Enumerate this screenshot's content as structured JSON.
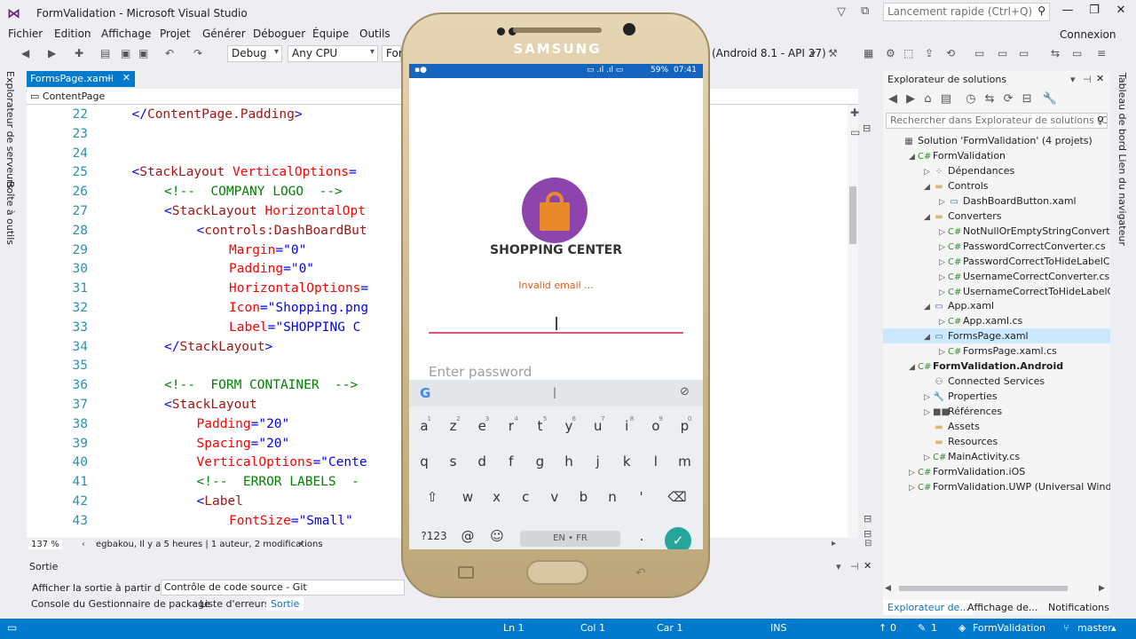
{
  "window": {
    "title": "FormValidation - Microsoft Visual Studio",
    "quick_launch": "Lancement rapide (Ctrl+Q)",
    "connexion": "Connexion"
  },
  "menu": [
    "Fichier",
    "Edition",
    "Affichage",
    "Projet",
    "Générer",
    "Déboguer",
    "Équipe",
    "Outils"
  ],
  "toolbar": {
    "config": "Debug",
    "platform": "Any CPU",
    "target_partial": "For",
    "device": "(Android 8.1 - API 27)"
  },
  "left_tabs": [
    "Explorateur de serveurs",
    "Boîte à outils"
  ],
  "editor": {
    "tab": "FormsPage.xaml",
    "breadcrumb": "ContentPage",
    "zoom": "137 %",
    "git_info": "egbakou, Il y a 5 heures | 1 auteur, 2 modifications",
    "lines": [
      {
        "n": "22",
        "i": 2,
        "parts": [
          [
            "pun",
            "</"
          ],
          [
            "tag",
            "ContentPage.Padding"
          ],
          [
            "pun",
            ">"
          ]
        ]
      },
      {
        "n": "23",
        "i": 0,
        "parts": []
      },
      {
        "n": "24",
        "i": 0,
        "parts": []
      },
      {
        "n": "25",
        "i": 2,
        "parts": [
          [
            "pun",
            "<"
          ],
          [
            "tag",
            "StackLayout "
          ],
          [
            "attr",
            "VerticalOptions"
          ],
          [
            "pun",
            "="
          ]
        ]
      },
      {
        "n": "26",
        "i": 3,
        "parts": [
          [
            "com",
            "<!--  COMPANY LOGO  -->"
          ]
        ]
      },
      {
        "n": "27",
        "i": 3,
        "parts": [
          [
            "pun",
            "<"
          ],
          [
            "tag",
            "StackLayout "
          ],
          [
            "attr",
            "HorizontalOpt"
          ]
        ]
      },
      {
        "n": "28",
        "i": 4,
        "parts": [
          [
            "pun",
            "<"
          ],
          [
            "tag",
            "controls:DashBoardBut"
          ]
        ]
      },
      {
        "n": "29",
        "i": 5,
        "parts": [
          [
            "attr",
            "Margin"
          ],
          [
            "pun",
            "=\"0\""
          ]
        ]
      },
      {
        "n": "30",
        "i": 5,
        "parts": [
          [
            "attr",
            "Padding"
          ],
          [
            "pun",
            "=\"0\""
          ]
        ]
      },
      {
        "n": "31",
        "i": 5,
        "parts": [
          [
            "attr",
            "HorizontalOptions"
          ],
          [
            "pun",
            "="
          ]
        ]
      },
      {
        "n": "32",
        "i": 5,
        "parts": [
          [
            "attr",
            "Icon"
          ],
          [
            "pun",
            "=\"Shopping.png"
          ]
        ]
      },
      {
        "n": "33",
        "i": 5,
        "parts": [
          [
            "attr",
            "Label"
          ],
          [
            "pun",
            "=\"SHOPPING C"
          ]
        ]
      },
      {
        "n": "34",
        "i": 3,
        "parts": [
          [
            "pun",
            "</"
          ],
          [
            "tag",
            "StackLayout"
          ],
          [
            "pun",
            ">"
          ]
        ]
      },
      {
        "n": "35",
        "i": 0,
        "parts": []
      },
      {
        "n": "36",
        "i": 3,
        "parts": [
          [
            "com",
            "<!--  FORM CONTAINER  -->"
          ]
        ]
      },
      {
        "n": "37",
        "i": 3,
        "parts": [
          [
            "pun",
            "<"
          ],
          [
            "tag",
            "StackLayout"
          ]
        ]
      },
      {
        "n": "38",
        "i": 4,
        "parts": [
          [
            "attr",
            "Padding"
          ],
          [
            "pun",
            "=\"20\""
          ]
        ]
      },
      {
        "n": "39",
        "i": 4,
        "parts": [
          [
            "attr",
            "Spacing"
          ],
          [
            "pun",
            "=\"20\""
          ]
        ]
      },
      {
        "n": "40",
        "i": 4,
        "parts": [
          [
            "attr",
            "VerticalOptions"
          ],
          [
            "pun",
            "=\"Cente"
          ]
        ]
      },
      {
        "n": "41",
        "i": 4,
        "parts": [
          [
            "com",
            "<!--  ERROR LABELS  -"
          ]
        ]
      },
      {
        "n": "42",
        "i": 4,
        "parts": [
          [
            "pun",
            "<"
          ],
          [
            "tag",
            "Label"
          ]
        ]
      },
      {
        "n": "43",
        "i": 5,
        "parts": [
          [
            "attr",
            "FontSize"
          ],
          [
            "pun",
            "=\"Small\""
          ]
        ]
      }
    ]
  },
  "output": {
    "title": "Sortie",
    "show_from_label": "Afficher la sortie à partir de :",
    "source": "Contrôle de code source - Git",
    "tabs": [
      "Console du Gestionnaire de package",
      "Liste d'erreurs",
      "Sortie"
    ]
  },
  "solution_explorer": {
    "title": "Explorateur de solutions",
    "search_placeholder": "Rechercher dans Explorateur de solutions (C",
    "items": [
      {
        "label": "Solution 'FormValidation' (4 projets)",
        "d": 0,
        "tw": "",
        "icon": "solution-icon",
        "bold": false
      },
      {
        "label": "FormValidation",
        "d": 1,
        "tw": "◢",
        "icon": "csproj-icon",
        "bold": false
      },
      {
        "label": "Dépendances",
        "d": 2,
        "tw": "▷",
        "icon": "dependencies-icon",
        "bold": false
      },
      {
        "label": "Controls",
        "d": 2,
        "tw": "◢",
        "icon": "folder-icon",
        "bold": false
      },
      {
        "label": "DashBoardButton.xaml",
        "d": 3,
        "tw": "▷",
        "icon": "xaml-icon",
        "bold": false
      },
      {
        "label": "Converters",
        "d": 2,
        "tw": "◢",
        "icon": "folder-icon",
        "bold": false
      },
      {
        "label": "NotNullOrEmptyStringConverter.cs",
        "d": 3,
        "tw": "▷",
        "icon": "cs-icon",
        "bold": false
      },
      {
        "label": "PasswordCorrectConverter.cs",
        "d": 3,
        "tw": "▷",
        "icon": "cs-icon",
        "bold": false
      },
      {
        "label": "PasswordCorrectToHideLabelConv",
        "d": 3,
        "tw": "▷",
        "icon": "cs-icon",
        "bold": false
      },
      {
        "label": "UsernameCorrectConverter.cs",
        "d": 3,
        "tw": "▷",
        "icon": "cs-icon",
        "bold": false
      },
      {
        "label": "UsernameCorrectToHideLabelConv",
        "d": 3,
        "tw": "▷",
        "icon": "cs-icon",
        "bold": false
      },
      {
        "label": "App.xaml",
        "d": 2,
        "tw": "◢",
        "icon": "xaml-icon",
        "bold": false
      },
      {
        "label": "App.xaml.cs",
        "d": 3,
        "tw": "▷",
        "icon": "cs-icon",
        "bold": false
      },
      {
        "label": "FormsPage.xaml",
        "d": 2,
        "tw": "◢",
        "icon": "xaml-icon",
        "bold": false,
        "selected": true
      },
      {
        "label": "FormsPage.xaml.cs",
        "d": 3,
        "tw": "▷",
        "icon": "cs-icon",
        "bold": false
      },
      {
        "label": "FormValidation.Android",
        "d": 1,
        "tw": "◢",
        "icon": "csproj-icon",
        "bold": true
      },
      {
        "label": "Connected Services",
        "d": 2,
        "tw": "",
        "icon": "connected-services-icon",
        "bold": false
      },
      {
        "label": "Properties",
        "d": 2,
        "tw": "▷",
        "icon": "wrench-icon",
        "bold": false
      },
      {
        "label": "Références",
        "d": 2,
        "tw": "▷",
        "icon": "references-icon",
        "bold": false
      },
      {
        "label": "Assets",
        "d": 2,
        "tw": "",
        "icon": "folder-icon",
        "bold": false
      },
      {
        "label": "Resources",
        "d": 2,
        "tw": "",
        "icon": "folder-icon",
        "bold": false
      },
      {
        "label": "MainActivity.cs",
        "d": 2,
        "tw": "▷",
        "icon": "cs-icon",
        "bold": false
      },
      {
        "label": "FormValidation.iOS",
        "d": 1,
        "tw": "▷",
        "icon": "csproj-icon",
        "bold": false
      },
      {
        "label": "FormValidation.UWP (Universal Windows)",
        "d": 1,
        "tw": "▷",
        "icon": "csproj-icon",
        "bold": false
      }
    ],
    "bottom_tabs": [
      "Explorateur de...",
      "Affichage de...",
      "Notifications"
    ]
  },
  "right_tabs": "Tableau de bord Lien du navigateur",
  "statusbar": {
    "ln": "Ln 1",
    "col": "Col 1",
    "car": "Car 1",
    "ins": "INS",
    "up": "0",
    "pencil": "1",
    "repo": "FormValidation",
    "branch": "master"
  },
  "phone": {
    "brand": "SAMSUNG",
    "status": {
      "battery": "59%",
      "time": "07:41"
    },
    "app_name": "SHOPPING CENTER",
    "error": "Invalid email ...",
    "password_placeholder": "Enter password",
    "keyboard": {
      "row1": [
        [
          "a",
          "1"
        ],
        [
          "z",
          "2"
        ],
        [
          "e",
          "3"
        ],
        [
          "r",
          "4"
        ],
        [
          "t",
          "5"
        ],
        [
          "y",
          "6"
        ],
        [
          "u",
          "7"
        ],
        [
          "i",
          "8"
        ],
        [
          "o",
          "9"
        ],
        [
          "p",
          "0"
        ]
      ],
      "row2": [
        "q",
        "s",
        "d",
        "f",
        "g",
        "h",
        "j",
        "k",
        "l",
        "m"
      ],
      "row3": [
        "w",
        "x",
        "c",
        "v",
        "b",
        "n",
        "'"
      ],
      "sym": "?123",
      "at": "@",
      "lang": "EN • FR",
      "dot": "."
    }
  },
  "colors": {
    "accent": "#007acc",
    "error": "#e05a1a",
    "underline": "#e3547a",
    "icon_bg": "#8e44ad",
    "bag": "#e8892b",
    "enter": "#26a69a"
  }
}
